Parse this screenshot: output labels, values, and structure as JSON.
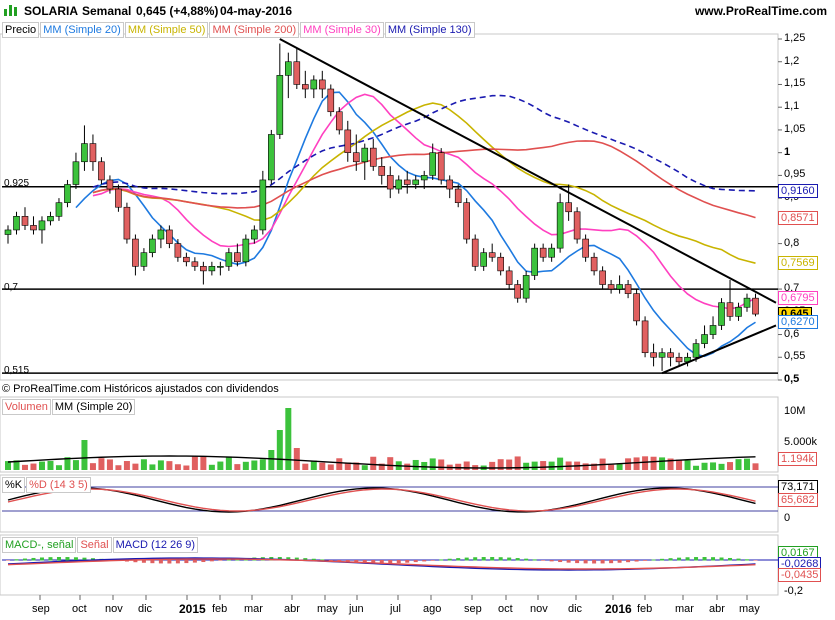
{
  "header": {
    "symbol": "SOLARIA",
    "timeframe": "Semanal",
    "price_change": "0,645 (+4,88%)",
    "date": "04-may-2016",
    "site": "www.ProRealTime.com"
  },
  "main_panel": {
    "legend": [
      "Precio",
      "MM (Simple 20)",
      "MM (Simple 50)",
      "MM (Simple 200)",
      "MM (Simple 30)",
      "MM (Simple 130)"
    ],
    "legend_colors": [
      "#000000",
      "#1e7ae0",
      "#c8b400",
      "#e05050",
      "#ff40c0",
      "#1a1ab0"
    ],
    "level_labels": [
      "0,925",
      "0,7",
      "0,515"
    ],
    "y_ticks": [
      "1,25",
      "1,2",
      "1,15",
      "1,1",
      "1,05",
      "1",
      "0,95",
      "0,9",
      "0,85",
      "0,8",
      "0,75",
      "0,7",
      "0,65",
      "0,6",
      "0,55",
      "0,5"
    ],
    "price_tags": [
      {
        "label": "0,9160",
        "color": "#1a1ab0"
      },
      {
        "label": "0,8571",
        "color": "#e05050"
      },
      {
        "label": "0,7569",
        "color": "#c8b400"
      },
      {
        "label": "0,6795",
        "color": "#ff40c0"
      },
      {
        "label": "0,645",
        "color": "#000000"
      },
      {
        "label": "0,6270",
        "color": "#1e7ae0"
      }
    ],
    "source_note": "© ProRealTime.com Históricos ajustados con dividendos"
  },
  "volume_panel": {
    "legend": [
      "Volumen",
      "MM (Simple 20)"
    ],
    "y_ticks": [
      "10M",
      "5.000k"
    ],
    "tag": "1.194k"
  },
  "stoch_panel": {
    "legend": [
      "%K",
      "%D (14 3 5)"
    ],
    "y_ticks": [
      "0"
    ],
    "tags": [
      {
        "label": "73,171",
        "color": "#000000"
      },
      {
        "label": "65,682",
        "color": "#e05050"
      }
    ]
  },
  "macd_panel": {
    "legend": [
      "MACD-, señal",
      "Señal",
      "MACD (12 26 9)"
    ],
    "y_ticks": [
      "-0,2"
    ],
    "tags": [
      {
        "label": "0,0167",
        "color": "#22a022"
      },
      {
        "label": "-0,0268",
        "color": "#1a1ab0"
      },
      {
        "label": "-0,0435",
        "color": "#e05050"
      }
    ]
  },
  "x_axis": {
    "labels": [
      "sep",
      "oct",
      "nov",
      "dic",
      "2015",
      "feb",
      "mar",
      "abr",
      "may",
      "jun",
      "jul",
      "ago",
      "sep",
      "oct",
      "nov",
      "dic",
      "2016",
      "feb",
      "mar",
      "abr",
      "may"
    ],
    "bold": [
      "2015",
      "2016"
    ]
  },
  "chart_data": {
    "type": "candlestick",
    "title": "SOLARIA Semanal",
    "ylim": [
      0.5,
      1.25
    ],
    "horizontal_levels": [
      0.925,
      0.7,
      0.515
    ],
    "candles": [
      [
        0.82,
        0.84,
        0.8,
        0.83
      ],
      [
        0.83,
        0.87,
        0.82,
        0.86
      ],
      [
        0.86,
        0.88,
        0.83,
        0.84
      ],
      [
        0.84,
        0.86,
        0.82,
        0.83
      ],
      [
        0.83,
        0.86,
        0.8,
        0.85
      ],
      [
        0.85,
        0.87,
        0.84,
        0.86
      ],
      [
        0.86,
        0.9,
        0.85,
        0.89
      ],
      [
        0.89,
        0.94,
        0.88,
        0.93
      ],
      [
        0.93,
        1.0,
        0.92,
        0.98
      ],
      [
        0.98,
        1.06,
        0.96,
        1.02
      ],
      [
        1.02,
        1.04,
        0.96,
        0.98
      ],
      [
        0.98,
        0.99,
        0.93,
        0.94
      ],
      [
        0.94,
        0.95,
        0.91,
        0.92
      ],
      [
        0.92,
        0.93,
        0.87,
        0.88
      ],
      [
        0.88,
        0.89,
        0.8,
        0.81
      ],
      [
        0.81,
        0.82,
        0.73,
        0.75
      ],
      [
        0.75,
        0.79,
        0.74,
        0.78
      ],
      [
        0.78,
        0.82,
        0.77,
        0.81
      ],
      [
        0.81,
        0.84,
        0.79,
        0.83
      ],
      [
        0.83,
        0.84,
        0.79,
        0.8
      ],
      [
        0.8,
        0.81,
        0.76,
        0.77
      ],
      [
        0.77,
        0.78,
        0.75,
        0.76
      ],
      [
        0.76,
        0.77,
        0.74,
        0.75
      ],
      [
        0.75,
        0.76,
        0.71,
        0.74
      ],
      [
        0.74,
        0.76,
        0.73,
        0.75
      ],
      [
        0.75,
        0.76,
        0.73,
        0.75
      ],
      [
        0.75,
        0.79,
        0.74,
        0.78
      ],
      [
        0.78,
        0.8,
        0.75,
        0.76
      ],
      [
        0.76,
        0.82,
        0.75,
        0.81
      ],
      [
        0.81,
        0.84,
        0.8,
        0.83
      ],
      [
        0.83,
        0.96,
        0.82,
        0.94
      ],
      [
        0.94,
        1.05,
        0.93,
        1.04
      ],
      [
        1.04,
        1.24,
        1.03,
        1.17
      ],
      [
        1.17,
        1.22,
        1.12,
        1.2
      ],
      [
        1.2,
        1.23,
        1.14,
        1.15
      ],
      [
        1.15,
        1.18,
        1.12,
        1.14
      ],
      [
        1.14,
        1.17,
        1.12,
        1.16
      ],
      [
        1.16,
        1.18,
        1.12,
        1.14
      ],
      [
        1.14,
        1.15,
        1.08,
        1.09
      ],
      [
        1.09,
        1.1,
        1.04,
        1.05
      ],
      [
        1.05,
        1.07,
        0.98,
        1.0
      ],
      [
        1.0,
        1.04,
        0.96,
        0.98
      ],
      [
        0.98,
        1.02,
        0.94,
        1.01
      ],
      [
        1.01,
        1.03,
        0.96,
        0.97
      ],
      [
        0.97,
        0.99,
        0.93,
        0.95
      ],
      [
        0.95,
        0.97,
        0.9,
        0.92
      ],
      [
        0.92,
        0.95,
        0.91,
        0.94
      ],
      [
        0.94,
        0.96,
        0.91,
        0.93
      ],
      [
        0.93,
        0.95,
        0.92,
        0.94
      ],
      [
        0.94,
        0.96,
        0.92,
        0.95
      ],
      [
        0.95,
        1.02,
        0.94,
        1.0
      ],
      [
        1.0,
        1.01,
        0.93,
        0.94
      ],
      [
        0.94,
        0.95,
        0.9,
        0.92
      ],
      [
        0.92,
        0.93,
        0.88,
        0.89
      ],
      [
        0.89,
        0.9,
        0.8,
        0.81
      ],
      [
        0.81,
        0.82,
        0.74,
        0.75
      ],
      [
        0.75,
        0.79,
        0.74,
        0.78
      ],
      [
        0.78,
        0.8,
        0.76,
        0.77
      ],
      [
        0.77,
        0.78,
        0.73,
        0.74
      ],
      [
        0.74,
        0.75,
        0.7,
        0.71
      ],
      [
        0.71,
        0.72,
        0.67,
        0.68
      ],
      [
        0.68,
        0.74,
        0.67,
        0.73
      ],
      [
        0.73,
        0.8,
        0.72,
        0.79
      ],
      [
        0.79,
        0.8,
        0.76,
        0.77
      ],
      [
        0.77,
        0.8,
        0.76,
        0.79
      ],
      [
        0.79,
        0.91,
        0.78,
        0.89
      ],
      [
        0.89,
        0.93,
        0.85,
        0.87
      ],
      [
        0.87,
        0.88,
        0.8,
        0.81
      ],
      [
        0.81,
        0.82,
        0.76,
        0.77
      ],
      [
        0.77,
        0.78,
        0.73,
        0.74
      ],
      [
        0.74,
        0.75,
        0.7,
        0.71
      ],
      [
        0.71,
        0.72,
        0.69,
        0.7
      ],
      [
        0.7,
        0.73,
        0.69,
        0.71
      ],
      [
        0.71,
        0.72,
        0.68,
        0.69
      ],
      [
        0.69,
        0.7,
        0.62,
        0.63
      ],
      [
        0.63,
        0.64,
        0.55,
        0.56
      ],
      [
        0.56,
        0.58,
        0.53,
        0.55
      ],
      [
        0.55,
        0.57,
        0.52,
        0.56
      ],
      [
        0.56,
        0.57,
        0.53,
        0.55
      ],
      [
        0.55,
        0.56,
        0.53,
        0.54
      ],
      [
        0.54,
        0.56,
        0.53,
        0.55
      ],
      [
        0.55,
        0.59,
        0.54,
        0.58
      ],
      [
        0.58,
        0.62,
        0.57,
        0.6
      ],
      [
        0.6,
        0.64,
        0.59,
        0.62
      ],
      [
        0.62,
        0.68,
        0.61,
        0.67
      ],
      [
        0.67,
        0.72,
        0.63,
        0.64
      ],
      [
        0.64,
        0.67,
        0.63,
        0.66
      ],
      [
        0.66,
        0.69,
        0.65,
        0.68
      ],
      [
        0.68,
        0.69,
        0.64,
        0.645
      ]
    ],
    "moving_averages": {
      "MM (Simple 20)": {
        "color": "#1e7ae0",
        "last": 0.627
      },
      "MM (Simple 50)": {
        "color": "#c8b400",
        "last": 0.7569
      },
      "MM (Simple 200)": {
        "color": "#e05050",
        "last": 0.8571
      },
      "MM (Simple 30)": {
        "color": "#ff40c0",
        "last": 0.6795
      },
      "MM (Simple 130)": {
        "color": "#1a1ab0",
        "last": 0.916
      }
    },
    "trendlines": [
      {
        "from": [
          32,
          1.25
        ],
        "to": [
          89,
          0.67
        ]
      },
      {
        "from": [
          77,
          0.515
        ],
        "to": [
          89,
          0.62
        ]
      }
    ]
  }
}
